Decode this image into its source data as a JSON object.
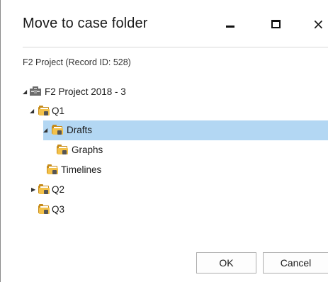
{
  "dialog": {
    "title": "Move to case folder",
    "window_controls": {
      "minimize": "minimize",
      "maximize": "maximize",
      "close": "×"
    },
    "record_label": "F2 Project (Record ID: 528)"
  },
  "tree": {
    "root": {
      "label": "F2 Project 2018 - 3",
      "icon": "project-icon",
      "expanded": true
    },
    "q1": {
      "label": "Q1",
      "icon": "folder-icon",
      "expanded": true
    },
    "drafts": {
      "label": "Drafts",
      "icon": "folder-icon",
      "expanded": true,
      "selected": true
    },
    "graphs": {
      "label": "Graphs",
      "icon": "folder-icon"
    },
    "timelines": {
      "label": "Timelines",
      "icon": "folder-icon"
    },
    "q2": {
      "label": "Q2",
      "icon": "folder-icon",
      "expanded": false
    },
    "q3": {
      "label": "Q3",
      "icon": "folder-icon"
    }
  },
  "buttons": {
    "ok": "OK",
    "cancel": "Cancel"
  },
  "colors": {
    "selection": "#b3d7f3",
    "folder": "#f3c14a"
  }
}
